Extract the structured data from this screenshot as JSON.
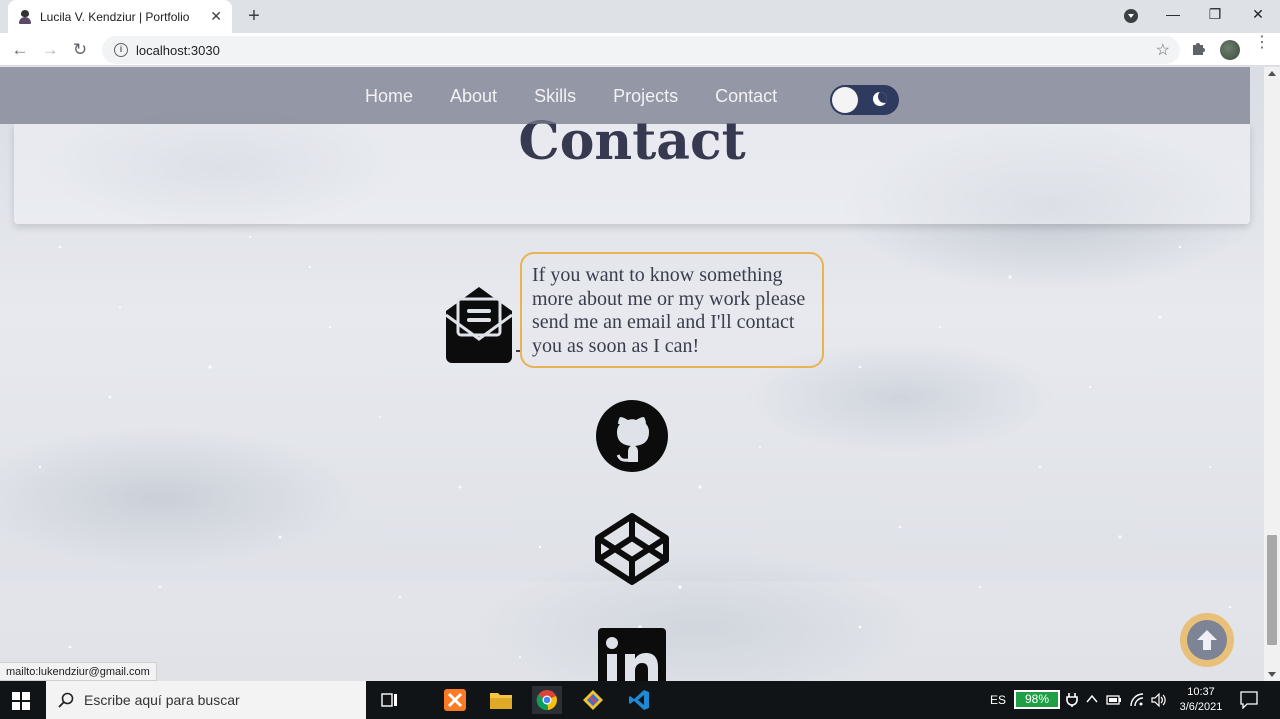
{
  "browser": {
    "tab_title": "Lucila V. Kendziur | Portfolio",
    "tab_close": "✕",
    "new_tab": "+",
    "url": "localhost:3030",
    "window_minimize": "—",
    "window_restore": "❐",
    "window_close": "✕",
    "back": "←",
    "forward": "→",
    "reload": "↻",
    "bookmark_star": "☆",
    "menu": "⋮",
    "info": "i"
  },
  "nav": {
    "links": [
      "Home",
      "About",
      "Skills",
      "Projects",
      "Contact"
    ],
    "theme_toggle": "dark"
  },
  "section": {
    "heading": "Contact",
    "message": "If you want to know something more about me or my work please send me an email and I'll contact you as soon as I can!"
  },
  "social": [
    "envelope-open-icon",
    "github-icon",
    "codepen-icon",
    "linkedin-icon"
  ],
  "status_bar": {
    "link_preview": "mailto:lukendziur@gmail.com"
  },
  "taskbar": {
    "search_placeholder": "Escribe aquí para buscar",
    "language": "ES",
    "battery": "98%",
    "time": "10:37",
    "date": "3/6/2021"
  },
  "colors": {
    "navbar": "#787c8c",
    "heading": "#363950",
    "bubble_border": "#e9b252",
    "toggle": "#2f3a5f",
    "scroll_top_ring": "#e8c07a"
  }
}
